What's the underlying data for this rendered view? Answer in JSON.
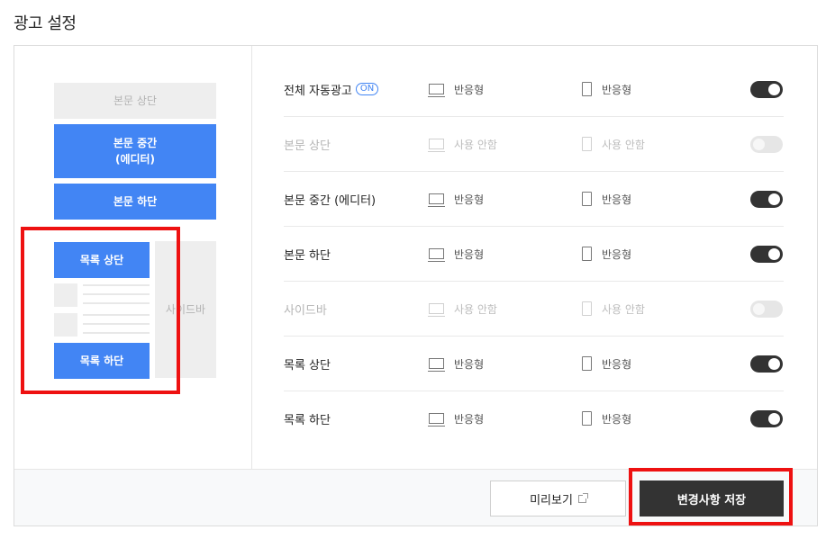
{
  "page": {
    "title": "광고 설정"
  },
  "layout_preview": {
    "body_top": "본문 상단",
    "body_middle_line1": "본문 중간",
    "body_middle_line2": "(에디터)",
    "body_bottom": "본문 하단",
    "list_top": "목록 상단",
    "list_bottom": "목록 하단",
    "sidebar": "사이드바"
  },
  "settings": {
    "rows": [
      {
        "label": "전체 자동광고",
        "badge": "ON",
        "pc": "반응형",
        "mobile": "반응형",
        "enabled": true
      },
      {
        "label": "본문 상단",
        "pc": "사용 안함",
        "mobile": "사용 안함",
        "enabled": false
      },
      {
        "label": "본문 중간 (에디터)",
        "pc": "반응형",
        "mobile": "반응형",
        "enabled": true
      },
      {
        "label": "본문 하단",
        "pc": "반응형",
        "mobile": "반응형",
        "enabled": true
      },
      {
        "label": "사이드바",
        "pc": "사용 안함",
        "mobile": "사용 안함",
        "enabled": false
      },
      {
        "label": "목록 상단",
        "pc": "반응형",
        "mobile": "반응형",
        "enabled": true
      },
      {
        "label": "목록 하단",
        "pc": "반응형",
        "mobile": "반응형",
        "enabled": true
      }
    ]
  },
  "footer": {
    "preview_label": "미리보기",
    "save_label": "변경사항 저장"
  },
  "colors": {
    "accent": "#4285f4",
    "toggle_on": "#333333",
    "highlight": "#ee1111"
  }
}
